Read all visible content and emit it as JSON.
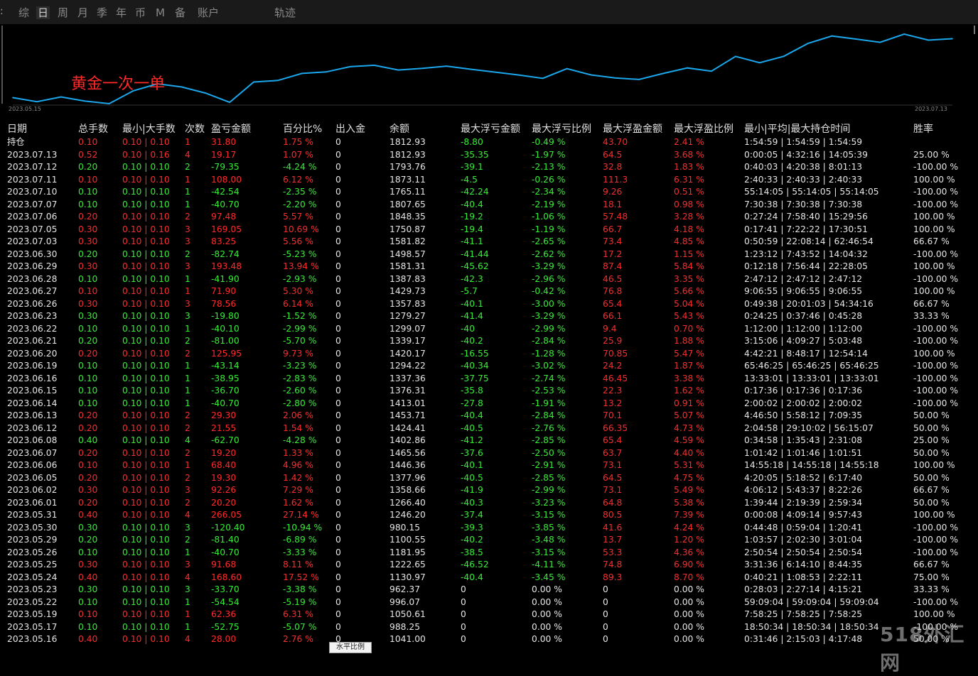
{
  "tabs": [
    "综",
    "日",
    "周",
    "月",
    "季",
    "年",
    "币",
    "M",
    "备",
    "账户",
    "轨迹"
  ],
  "active_tab": "日",
  "chart_data": {
    "type": "line",
    "title": "黄金一次一单",
    "x_start": "2023.05.15",
    "x_end": "2023.07.13",
    "x": [
      "2023.05.16",
      "2023.05.17",
      "2023.05.19",
      "2023.05.22",
      "2023.05.23",
      "2023.05.24",
      "2023.05.25",
      "2023.05.26",
      "2023.05.29",
      "2023.05.30",
      "2023.05.31",
      "2023.06.01",
      "2023.06.02",
      "2023.06.05",
      "2023.06.06",
      "2023.06.07",
      "2023.06.08",
      "2023.06.12",
      "2023.06.13",
      "2023.06.14",
      "2023.06.15",
      "2023.06.16",
      "2023.06.19",
      "2023.06.20",
      "2023.06.21",
      "2023.06.22",
      "2023.06.23",
      "2023.06.26",
      "2023.06.27",
      "2023.06.28",
      "2023.06.29",
      "2023.06.30",
      "2023.07.03",
      "2023.07.05",
      "2023.07.06",
      "2023.07.07",
      "2023.07.10",
      "2023.07.11",
      "2023.07.12",
      "2023.07.13"
    ],
    "values": [
      1041.0,
      988.25,
      1050.61,
      996.07,
      962.37,
      1130.97,
      1222.65,
      1181.95,
      1100.55,
      980.15,
      1246.2,
      1266.4,
      1358.66,
      1377.96,
      1446.36,
      1465.56,
      1402.86,
      1424.41,
      1453.71,
      1413.01,
      1376.31,
      1337.36,
      1294.22,
      1420.17,
      1339.17,
      1299.07,
      1279.27,
      1357.83,
      1429.73,
      1387.83,
      1581.31,
      1498.57,
      1581.82,
      1750.87,
      1848.35,
      1807.65,
      1765.11,
      1873.11,
      1793.76,
      1812.93
    ],
    "color": "#1aa7ec"
  },
  "table": {
    "headers": [
      "日期",
      "总手数",
      "最小|大手数",
      "次数",
      "盈亏金额",
      "百分比%",
      "出入金",
      "余额",
      "最大浮亏金额",
      "最大浮亏比例",
      "最大浮盈金额",
      "最大浮盈比例",
      "最小|平均|最大持仓时间",
      "胜率"
    ],
    "rows": [
      [
        "持仓",
        "0.10",
        "0.10 | 0.10",
        "1",
        "31.80",
        "1.75 %",
        "0",
        "1812.93",
        "-8.80",
        "-0.49 %",
        "43.70",
        "2.41 %",
        "1:54:59 | 1:54:59 | 1:54:59",
        ""
      ],
      [
        "2023.07.13",
        "0.52",
        "0.10 | 0.16",
        "4",
        "19.17",
        "1.07 %",
        "0",
        "1812.93",
        "-35.35",
        "-1.97 %",
        "64.5",
        "3.68 %",
        "0:00:05 | 4:32:16 | 14:05:39",
        "25.00 %"
      ],
      [
        "2023.07.12",
        "0.20",
        "0.10 | 0.10",
        "2",
        "-79.35",
        "-4.24 %",
        "0",
        "1793.76",
        "-39.1",
        "-2.13 %",
        "32.8",
        "1.83 %",
        "0:40:03 | 4:20:38 | 8:01:13",
        "-100.00 %"
      ],
      [
        "2023.07.11",
        "0.10",
        "0.10 | 0.10",
        "1",
        "108.00",
        "6.12 %",
        "0",
        "1873.11",
        "-4.5",
        "-0.26 %",
        "111.3",
        "6.31 %",
        "2:40:33 | 2:40:33 | 2:40:33",
        "100.00 %"
      ],
      [
        "2023.07.10",
        "0.10",
        "0.10 | 0.10",
        "1",
        "-42.54",
        "-2.35 %",
        "0",
        "1765.11",
        "-42.24",
        "-2.34 %",
        "9.26",
        "0.51 %",
        "55:14:05 | 55:14:05 | 55:14:05",
        "-100.00 %"
      ],
      [
        "2023.07.07",
        "0.10",
        "0.10 | 0.10",
        "1",
        "-40.70",
        "-2.20 %",
        "0",
        "1807.65",
        "-40.4",
        "-2.19 %",
        "18.1",
        "0.98 %",
        "7:30:38 | 7:30:38 | 7:30:38",
        "-100.00 %"
      ],
      [
        "2023.07.06",
        "0.20",
        "0.10 | 0.10",
        "2",
        "97.48",
        "5.57 %",
        "0",
        "1848.35",
        "-19.2",
        "-1.06 %",
        "57.48",
        "3.28 %",
        "0:27:24 | 7:58:40 | 15:29:56",
        "100.00 %"
      ],
      [
        "2023.07.05",
        "0.30",
        "0.10 | 0.10",
        "3",
        "169.05",
        "10.69 %",
        "0",
        "1750.87",
        "-19.4",
        "-1.19 %",
        "66.7",
        "4.18 %",
        "0:17:41 | 7:22:22 | 17:30:51",
        "100.00 %"
      ],
      [
        "2023.07.03",
        "0.30",
        "0.10 | 0.10",
        "3",
        "83.25",
        "5.56 %",
        "0",
        "1581.82",
        "-41.1",
        "-2.65 %",
        "73.4",
        "4.85 %",
        "0:50:59 | 22:08:14 | 62:46:54",
        "66.67 %"
      ],
      [
        "2023.06.30",
        "0.20",
        "0.10 | 0.10",
        "2",
        "-82.74",
        "-5.23 %",
        "0",
        "1498.57",
        "-41.44",
        "-2.62 %",
        "17.2",
        "1.15 %",
        "1:23:12 | 7:43:52 | 14:04:32",
        "-100.00 %"
      ],
      [
        "2023.06.29",
        "0.30",
        "0.10 | 0.10",
        "3",
        "193.48",
        "13.94 %",
        "0",
        "1581.31",
        "-45.62",
        "-3.29 %",
        "87.4",
        "5.84 %",
        "0:12:18 | 7:56:44 | 22:28:05",
        "100.00 %"
      ],
      [
        "2023.06.28",
        "0.10",
        "0.10 | 0.10",
        "1",
        "-41.90",
        "-2.93 %",
        "0",
        "1387.83",
        "-42.3",
        "-2.96 %",
        "46.5",
        "3.35 %",
        "2:47:12 | 2:47:12 | 2:47:12",
        "-100.00 %"
      ],
      [
        "2023.06.27",
        "0.10",
        "0.10 | 0.10",
        "1",
        "71.90",
        "5.30 %",
        "0",
        "1429.73",
        "-5.7",
        "-0.42 %",
        "76.8",
        "5.66 %",
        "9:06:55 | 9:06:55 | 9:06:55",
        "100.00 %"
      ],
      [
        "2023.06.26",
        "0.30",
        "0.10 | 0.10",
        "3",
        "78.56",
        "6.14 %",
        "0",
        "1357.83",
        "-40.1",
        "-3.00 %",
        "65.4",
        "5.04 %",
        "0:49:38 | 20:01:03 | 54:34:16",
        "66.67 %"
      ],
      [
        "2023.06.23",
        "0.30",
        "0.10 | 0.10",
        "3",
        "-19.80",
        "-1.52 %",
        "0",
        "1279.27",
        "-41.4",
        "-3.29 %",
        "66.1",
        "5.43 %",
        "0:24:25 | 0:37:46 | 0:45:28",
        "33.33 %"
      ],
      [
        "2023.06.22",
        "0.10",
        "0.10 | 0.10",
        "1",
        "-40.10",
        "-2.99 %",
        "0",
        "1299.07",
        "-40",
        "-2.99 %",
        "9.4",
        "0.70 %",
        "1:12:00 | 1:12:00 | 1:12:00",
        "-100.00 %"
      ],
      [
        "2023.06.21",
        "0.20",
        "0.10 | 0.10",
        "2",
        "-81.00",
        "-5.70 %",
        "0",
        "1339.17",
        "-40.2",
        "-2.84 %",
        "25.9",
        "1.88 %",
        "3:15:06 | 4:09:27 | 5:03:48",
        "-100.00 %"
      ],
      [
        "2023.06.20",
        "0.20",
        "0.10 | 0.10",
        "2",
        "125.95",
        "9.73 %",
        "0",
        "1420.17",
        "-16.55",
        "-1.28 %",
        "70.85",
        "5.47 %",
        "4:42:21 | 8:48:17 | 12:54:14",
        "100.00 %"
      ],
      [
        "2023.06.19",
        "0.10",
        "0.10 | 0.10",
        "1",
        "-43.14",
        "-3.23 %",
        "0",
        "1294.22",
        "-40.34",
        "-3.02 %",
        "24.2",
        "1.87 %",
        "65:46:25 | 65:46:25 | 65:46:25",
        "-100.00 %"
      ],
      [
        "2023.06.16",
        "0.10",
        "0.10 | 0.10",
        "1",
        "-38.95",
        "-2.83 %",
        "0",
        "1337.36",
        "-37.75",
        "-2.74 %",
        "46.45",
        "3.38 %",
        "13:33:01 | 13:33:01 | 13:33:01",
        "-100.00 %"
      ],
      [
        "2023.06.15",
        "0.10",
        "0.10 | 0.10",
        "1",
        "-36.70",
        "-2.60 %",
        "0",
        "1376.31",
        "-35.8",
        "-2.53 %",
        "22.3",
        "1.62 %",
        "0:17:36 | 0:17:36 | 0:17:36",
        "-100.00 %"
      ],
      [
        "2023.06.14",
        "0.10",
        "0.10 | 0.10",
        "1",
        "-40.70",
        "-2.80 %",
        "0",
        "1413.01",
        "-27.8",
        "-1.91 %",
        "13.2",
        "0.91 %",
        "2:00:02 | 2:00:02 | 2:00:02",
        "-100.00 %"
      ],
      [
        "2023.06.13",
        "0.20",
        "0.10 | 0.10",
        "2",
        "29.30",
        "2.06 %",
        "0",
        "1453.71",
        "-40.4",
        "-2.84 %",
        "70.1",
        "5.07 %",
        "4:46:50 | 5:58:12 | 7:09:35",
        "50.00 %"
      ],
      [
        "2023.06.12",
        "0.20",
        "0.10 | 0.10",
        "2",
        "21.55",
        "1.54 %",
        "0",
        "1424.41",
        "-40.5",
        "-2.76 %",
        "66.35",
        "4.73 %",
        "2:04:58 | 29:10:02 | 56:15:07",
        "50.00 %"
      ],
      [
        "2023.06.08",
        "0.40",
        "0.10 | 0.10",
        "4",
        "-62.70",
        "-4.28 %",
        "0",
        "1402.86",
        "-41.2",
        "-2.85 %",
        "65.4",
        "4.59 %",
        "0:34:58 | 1:35:43 | 2:31:08",
        "25.00 %"
      ],
      [
        "2023.06.07",
        "0.20",
        "0.10 | 0.10",
        "2",
        "19.20",
        "1.33 %",
        "0",
        "1465.56",
        "-37.6",
        "-2.50 %",
        "63.7",
        "4.40 %",
        "1:01:42 | 1:01:46 | 1:01:51",
        "50.00 %"
      ],
      [
        "2023.06.06",
        "0.10",
        "0.10 | 0.10",
        "1",
        "68.40",
        "4.96 %",
        "0",
        "1446.36",
        "-40.1",
        "-2.91 %",
        "73.1",
        "5.31 %",
        "14:55:18 | 14:55:18 | 14:55:18",
        "100.00 %"
      ],
      [
        "2023.06.05",
        "0.20",
        "0.10 | 0.10",
        "2",
        "19.30",
        "1.42 %",
        "0",
        "1377.96",
        "-40.5",
        "-2.85 %",
        "64.5",
        "4.75 %",
        "4:20:05 | 5:18:52 | 6:17:40",
        "50.00 %"
      ],
      [
        "2023.06.02",
        "0.30",
        "0.10 | 0.10",
        "3",
        "92.26",
        "7.29 %",
        "0",
        "1358.66",
        "-41.9",
        "-2.99 %",
        "73.1",
        "5.49 %",
        "4:06:12 | 5:43:37 | 8:22:26",
        "66.67 %"
      ],
      [
        "2023.06.01",
        "0.20",
        "0.10 | 0.10",
        "2",
        "20.20",
        "1.62 %",
        "0",
        "1266.40",
        "-40.3",
        "-3.23 %",
        "64.8",
        "5.38 %",
        "1:39:44 | 2:19:39 | 2:59:34",
        "50.00 %"
      ],
      [
        "2023.05.31",
        "0.40",
        "0.10 | 0.10",
        "4",
        "266.05",
        "27.14 %",
        "0",
        "1246.20",
        "-37.4",
        "-3.15 %",
        "80.5",
        "7.39 %",
        "0:00:08 | 4:09:14 | 9:57:43",
        "100.00 %"
      ],
      [
        "2023.05.30",
        "0.30",
        "0.10 | 0.10",
        "3",
        "-120.40",
        "-10.94 %",
        "0",
        "980.15",
        "-39.3",
        "-3.85 %",
        "41.6",
        "4.24 %",
        "0:44:48 | 0:59:04 | 1:20:41",
        "-100.00 %"
      ],
      [
        "2023.05.29",
        "0.20",
        "0.10 | 0.10",
        "2",
        "-81.40",
        "-6.89 %",
        "0",
        "1100.55",
        "-40.2",
        "-3.48 %",
        "13.7",
        "1.20 %",
        "1:03:57 | 2:02:30 | 3:01:04",
        "-100.00 %"
      ],
      [
        "2023.05.26",
        "0.10",
        "0.10 | 0.10",
        "1",
        "-40.70",
        "-3.33 %",
        "0",
        "1181.95",
        "-38.5",
        "-3.15 %",
        "53.3",
        "4.36 %",
        "2:50:54 | 2:50:54 | 2:50:54",
        "-100.00 %"
      ],
      [
        "2023.05.25",
        "0.30",
        "0.10 | 0.10",
        "3",
        "91.68",
        "8.11 %",
        "0",
        "1222.65",
        "-46.52",
        "-4.11 %",
        "74.8",
        "6.90 %",
        "3:31:36 | 6:14:10 | 8:44:35",
        "66.67 %"
      ],
      [
        "2023.05.24",
        "0.40",
        "0.10 | 0.10",
        "4",
        "168.60",
        "17.52 %",
        "0",
        "1130.97",
        "-40.4",
        "-3.45 %",
        "89.3",
        "8.70 %",
        "0:40:21 | 1:08:53 | 2:22:11",
        "75.00 %"
      ],
      [
        "2023.05.23",
        "0.30",
        "0.10 | 0.10",
        "3",
        "-33.70",
        "-3.38 %",
        "0",
        "962.37",
        "0",
        "0.00 %",
        "0",
        "0.00 %",
        "0:28:03 | 2:27:14 | 4:15:21",
        "33.33 %"
      ],
      [
        "2023.05.22",
        "0.10",
        "0.10 | 0.10",
        "1",
        "-54.54",
        "-5.19 %",
        "0",
        "996.07",
        "0",
        "0.00 %",
        "0",
        "0.00 %",
        "59:09:04 | 59:09:04 | 59:09:04",
        "-100.00 %"
      ],
      [
        "2023.05.19",
        "0.10",
        "0.10 | 0.10",
        "1",
        "62.36",
        "6.31 %",
        "0",
        "1050.61",
        "0",
        "0.00 %",
        "0",
        "0.00 %",
        "7:58:25 | 7:58:25 | 7:58:25",
        "100.00 %"
      ],
      [
        "2023.05.17",
        "0.10",
        "0.10 | 0.10",
        "1",
        "-52.75",
        "-5.07 %",
        "0",
        "988.25",
        "0",
        "0.00 %",
        "0",
        "0.00 %",
        "18:50:34 | 18:50:34 | 18:50:34",
        "-100.00 %"
      ],
      [
        "2023.05.16",
        "0.40",
        "0.10 | 0.10",
        "4",
        "28.00",
        "2.76 %",
        "0",
        "1041.00",
        "0",
        "0.00 %",
        "0",
        "0.00 %",
        "0:31:46 | 2:15:03 | 4:17:48",
        "50.00 %"
      ]
    ]
  },
  "tooltip_text": "水平比例",
  "watermark": "518外汇网",
  "colors": {
    "profit": "#ff2b2b",
    "loss": "#34ef34",
    "neutral": "#e6e6e6",
    "line": "#1aa7ec"
  }
}
